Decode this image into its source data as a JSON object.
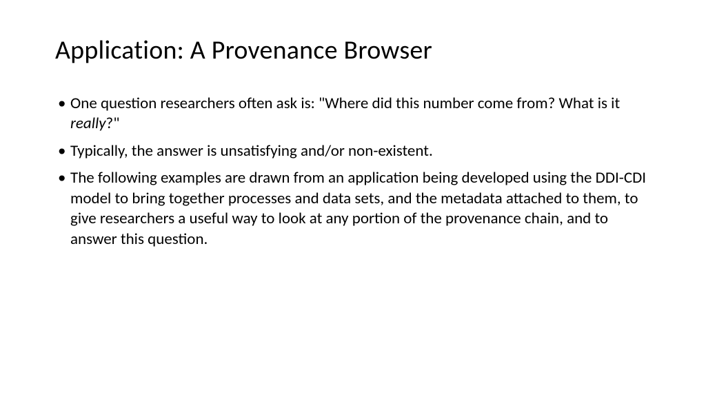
{
  "slide": {
    "title": "Application: A Provenance Browser",
    "bullets": [
      {
        "prefix": "One question researchers often ask is: \"Where did this number come from? What is it ",
        "italic": "really",
        "suffix": "?\""
      },
      {
        "text": "Typically, the answer is unsatisfying and/or non-existent."
      },
      {
        "text": "The following examples are drawn from an application being developed using the DDI-CDI model to bring together processes and data sets, and the metadata attached to them, to give researchers a useful way to look at any portion of the provenance chain, and to answer this question."
      }
    ]
  }
}
